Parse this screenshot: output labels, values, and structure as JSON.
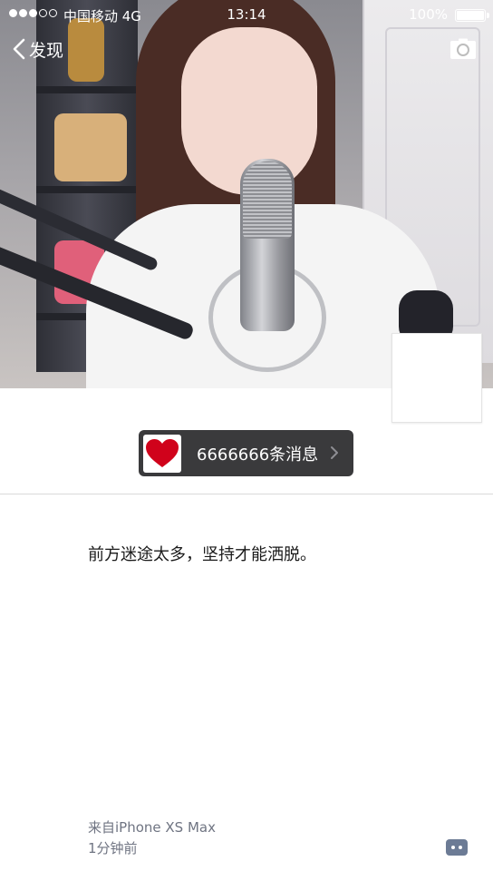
{
  "status_bar": {
    "signal_bars_filled": 3,
    "signal_bars_total": 5,
    "carrier": "中国移动 4G",
    "time": "13:14",
    "battery_text": "100%",
    "battery_level": 1.0
  },
  "nav": {
    "back_label": "发现",
    "back_icon": "chevron-left-icon",
    "camera_icon": "camera-icon"
  },
  "cover": {
    "alt": "live streamer cover photo"
  },
  "message_pill": {
    "icon": "heart-icon",
    "label": "6666666条消息",
    "chevron_icon": "chevron-right-icon"
  },
  "post": {
    "text": "前方迷途太多，坚持才能洒脱。"
  },
  "footer": {
    "source": "来自iPhone XS Max",
    "time": "1分钟前",
    "comment_icon": "comment-icon"
  },
  "colors": {
    "pill_background": "#3a3a3c",
    "heart": "#d0021b",
    "meta_text": "#6f7482",
    "comment_icon": "#6c7b95"
  }
}
